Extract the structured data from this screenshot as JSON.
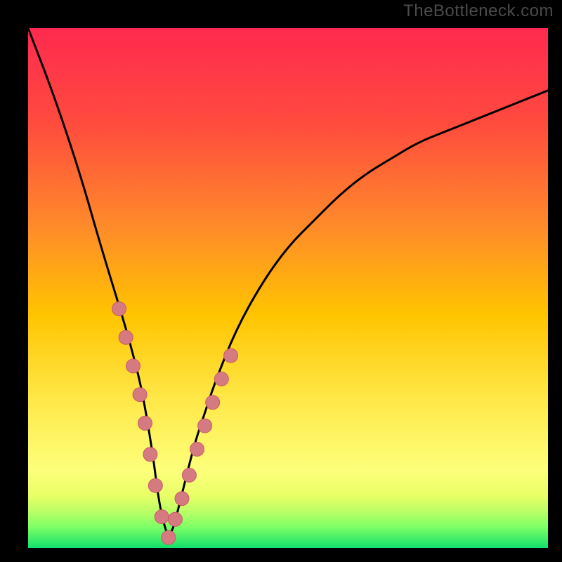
{
  "watermark": "TheBottleneck.com",
  "colors": {
    "frame_bg": "#000000",
    "curve": "#000000",
    "dot_fill": "#d67a82",
    "dot_stroke": "#c95b66",
    "grad_top": "#ff2a4f",
    "grad_mid_upper": "#ff6a2f",
    "grad_mid": "#ffc400",
    "grad_mid_lower": "#fff07a",
    "grad_band": "#e8ff66",
    "grad_green_top": "#9dff66",
    "grad_green_bottom": "#11e06b"
  },
  "chart_data": {
    "type": "line",
    "title": "",
    "xlabel": "",
    "ylabel": "",
    "xlim": [
      0,
      100
    ],
    "ylim": [
      0,
      100
    ],
    "note": "Axes are unlabeled in the image; x/y in 0-100 abstract units. Curve is a V-shaped bottleneck plot with minimum near x≈27. Values are estimated from pixel positions.",
    "series": [
      {
        "name": "bottleneck-curve",
        "x": [
          0,
          5,
          10,
          14,
          18,
          20,
          22,
          24,
          25,
          26,
          27,
          28,
          29,
          30,
          32,
          34,
          36,
          40,
          45,
          50,
          55,
          60,
          65,
          70,
          75,
          80,
          85,
          90,
          95,
          100
        ],
        "y": [
          100,
          87,
          72,
          58,
          45,
          38,
          30,
          18,
          10,
          5,
          2,
          4,
          8,
          12,
          20,
          26,
          32,
          42,
          51,
          58,
          63,
          68,
          72,
          75,
          78,
          80,
          82,
          84,
          86,
          88
        ]
      },
      {
        "name": "highlight-dots",
        "x": [
          17.5,
          18.8,
          20.2,
          21.5,
          22.5,
          23.5,
          24.5,
          25.7,
          27.0,
          28.3,
          29.6,
          31.0,
          32.5,
          34.0,
          35.5,
          37.2,
          39.0
        ],
        "y": [
          46.0,
          40.5,
          35.0,
          29.5,
          24.0,
          18.0,
          12.0,
          6.0,
          2.0,
          5.5,
          9.5,
          14.0,
          19.0,
          23.5,
          28.0,
          32.5,
          37.0
        ]
      }
    ]
  }
}
